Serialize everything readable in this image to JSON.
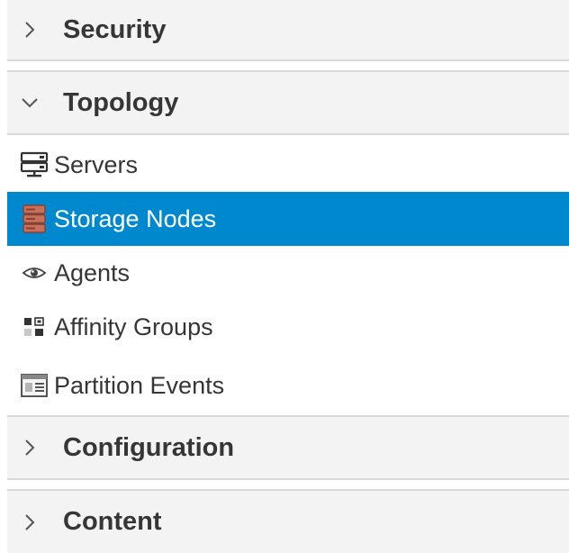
{
  "nav": {
    "sections": {
      "security": {
        "label": "Security",
        "expanded": false
      },
      "topology": {
        "label": "Topology",
        "expanded": true
      },
      "configuration": {
        "label": "Configuration",
        "expanded": false
      },
      "content": {
        "label": "Content",
        "expanded": false
      }
    },
    "topology_items": {
      "servers": {
        "label": "Servers",
        "icon": "server-icon"
      },
      "storage_nodes": {
        "label": "Storage Nodes",
        "icon": "storage-node-icon",
        "selected": true
      },
      "agents": {
        "label": "Agents",
        "icon": "eye-icon"
      },
      "affinity_groups": {
        "label": "Affinity Groups",
        "icon": "affinity-group-icon"
      },
      "partition_events": {
        "label": "Partition Events",
        "icon": "event-log-icon"
      }
    }
  },
  "colors": {
    "selected_bg": "#0088ce",
    "section_bg": "#f3f3f3",
    "text": "#363636"
  }
}
